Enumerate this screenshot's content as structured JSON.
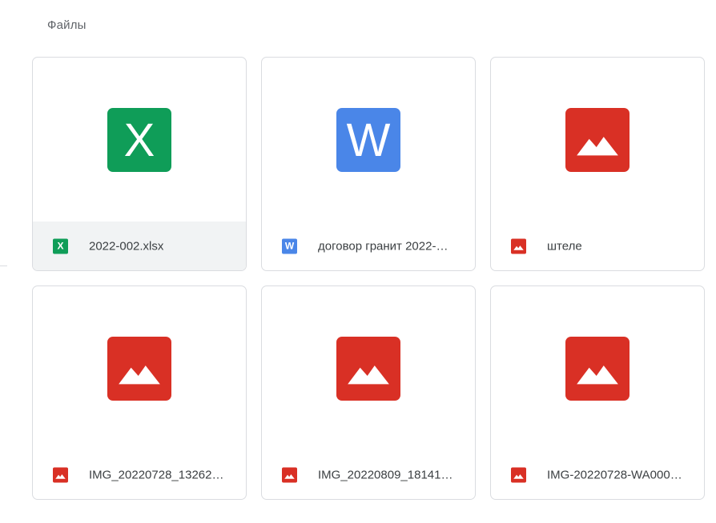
{
  "section": {
    "title": "Файлы"
  },
  "colors": {
    "excel": "#0f9d58",
    "word": "#4a86e8",
    "image": "#d93025"
  },
  "files": [
    {
      "name": "2022-002.xlsx",
      "type": "excel",
      "icon_letter": "X",
      "icon": "excel-icon",
      "selected": true
    },
    {
      "name": "договор гранит 2022-…",
      "type": "word",
      "icon_letter": "W",
      "icon": "word-icon",
      "selected": false
    },
    {
      "name": "штеле",
      "type": "image",
      "icon_letter": "",
      "icon": "image-icon",
      "selected": false
    },
    {
      "name": "IMG_20220728_13262…",
      "type": "image",
      "icon_letter": "",
      "icon": "image-icon",
      "selected": false
    },
    {
      "name": "IMG_20220809_18141…",
      "type": "image",
      "icon_letter": "",
      "icon": "image-icon",
      "selected": false
    },
    {
      "name": "IMG-20220728-WA000…",
      "type": "image",
      "icon_letter": "",
      "icon": "image-icon",
      "selected": false
    }
  ]
}
